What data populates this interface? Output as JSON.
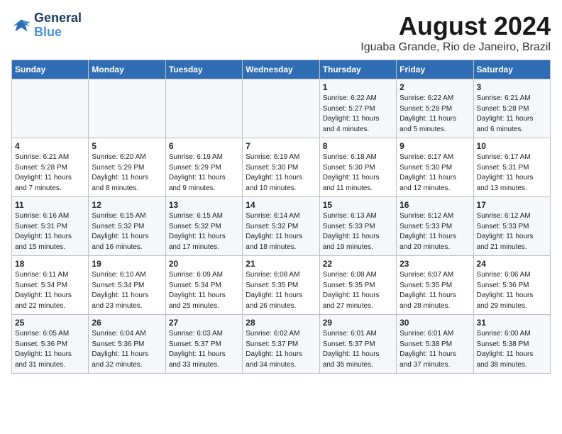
{
  "logo": {
    "line1": "General",
    "line2": "Blue"
  },
  "title": "August 2024",
  "subtitle": "Iguaba Grande, Rio de Janeiro, Brazil",
  "headers": [
    "Sunday",
    "Monday",
    "Tuesday",
    "Wednesday",
    "Thursday",
    "Friday",
    "Saturday"
  ],
  "weeks": [
    [
      {
        "day": "",
        "text": ""
      },
      {
        "day": "",
        "text": ""
      },
      {
        "day": "",
        "text": ""
      },
      {
        "day": "",
        "text": ""
      },
      {
        "day": "1",
        "text": "Sunrise: 6:22 AM\nSunset: 5:27 PM\nDaylight: 11 hours\nand 4 minutes."
      },
      {
        "day": "2",
        "text": "Sunrise: 6:22 AM\nSunset: 5:28 PM\nDaylight: 11 hours\nand 5 minutes."
      },
      {
        "day": "3",
        "text": "Sunrise: 6:21 AM\nSunset: 5:28 PM\nDaylight: 11 hours\nand 6 minutes."
      }
    ],
    [
      {
        "day": "4",
        "text": "Sunrise: 6:21 AM\nSunset: 5:28 PM\nDaylight: 11 hours\nand 7 minutes."
      },
      {
        "day": "5",
        "text": "Sunrise: 6:20 AM\nSunset: 5:29 PM\nDaylight: 11 hours\nand 8 minutes."
      },
      {
        "day": "6",
        "text": "Sunrise: 6:19 AM\nSunset: 5:29 PM\nDaylight: 11 hours\nand 9 minutes."
      },
      {
        "day": "7",
        "text": "Sunrise: 6:19 AM\nSunset: 5:30 PM\nDaylight: 11 hours\nand 10 minutes."
      },
      {
        "day": "8",
        "text": "Sunrise: 6:18 AM\nSunset: 5:30 PM\nDaylight: 11 hours\nand 11 minutes."
      },
      {
        "day": "9",
        "text": "Sunrise: 6:17 AM\nSunset: 5:30 PM\nDaylight: 11 hours\nand 12 minutes."
      },
      {
        "day": "10",
        "text": "Sunrise: 6:17 AM\nSunset: 5:31 PM\nDaylight: 11 hours\nand 13 minutes."
      }
    ],
    [
      {
        "day": "11",
        "text": "Sunrise: 6:16 AM\nSunset: 5:31 PM\nDaylight: 11 hours\nand 15 minutes."
      },
      {
        "day": "12",
        "text": "Sunrise: 6:15 AM\nSunset: 5:32 PM\nDaylight: 11 hours\nand 16 minutes."
      },
      {
        "day": "13",
        "text": "Sunrise: 6:15 AM\nSunset: 5:32 PM\nDaylight: 11 hours\nand 17 minutes."
      },
      {
        "day": "14",
        "text": "Sunrise: 6:14 AM\nSunset: 5:32 PM\nDaylight: 11 hours\nand 18 minutes."
      },
      {
        "day": "15",
        "text": "Sunrise: 6:13 AM\nSunset: 5:33 PM\nDaylight: 11 hours\nand 19 minutes."
      },
      {
        "day": "16",
        "text": "Sunrise: 6:12 AM\nSunset: 5:33 PM\nDaylight: 11 hours\nand 20 minutes."
      },
      {
        "day": "17",
        "text": "Sunrise: 6:12 AM\nSunset: 5:33 PM\nDaylight: 11 hours\nand 21 minutes."
      }
    ],
    [
      {
        "day": "18",
        "text": "Sunrise: 6:11 AM\nSunset: 5:34 PM\nDaylight: 11 hours\nand 22 minutes."
      },
      {
        "day": "19",
        "text": "Sunrise: 6:10 AM\nSunset: 5:34 PM\nDaylight: 11 hours\nand 23 minutes."
      },
      {
        "day": "20",
        "text": "Sunrise: 6:09 AM\nSunset: 5:34 PM\nDaylight: 11 hours\nand 25 minutes."
      },
      {
        "day": "21",
        "text": "Sunrise: 6:08 AM\nSunset: 5:35 PM\nDaylight: 11 hours\nand 26 minutes."
      },
      {
        "day": "22",
        "text": "Sunrise: 6:08 AM\nSunset: 5:35 PM\nDaylight: 11 hours\nand 27 minutes."
      },
      {
        "day": "23",
        "text": "Sunrise: 6:07 AM\nSunset: 5:35 PM\nDaylight: 11 hours\nand 28 minutes."
      },
      {
        "day": "24",
        "text": "Sunrise: 6:06 AM\nSunset: 5:36 PM\nDaylight: 11 hours\nand 29 minutes."
      }
    ],
    [
      {
        "day": "25",
        "text": "Sunrise: 6:05 AM\nSunset: 5:36 PM\nDaylight: 11 hours\nand 31 minutes."
      },
      {
        "day": "26",
        "text": "Sunrise: 6:04 AM\nSunset: 5:36 PM\nDaylight: 11 hours\nand 32 minutes."
      },
      {
        "day": "27",
        "text": "Sunrise: 6:03 AM\nSunset: 5:37 PM\nDaylight: 11 hours\nand 33 minutes."
      },
      {
        "day": "28",
        "text": "Sunrise: 6:02 AM\nSunset: 5:37 PM\nDaylight: 11 hours\nand 34 minutes."
      },
      {
        "day": "29",
        "text": "Sunrise: 6:01 AM\nSunset: 5:37 PM\nDaylight: 11 hours\nand 35 minutes."
      },
      {
        "day": "30",
        "text": "Sunrise: 6:01 AM\nSunset: 5:38 PM\nDaylight: 11 hours\nand 37 minutes."
      },
      {
        "day": "31",
        "text": "Sunrise: 6:00 AM\nSunset: 5:38 PM\nDaylight: 11 hours\nand 38 minutes."
      }
    ]
  ]
}
